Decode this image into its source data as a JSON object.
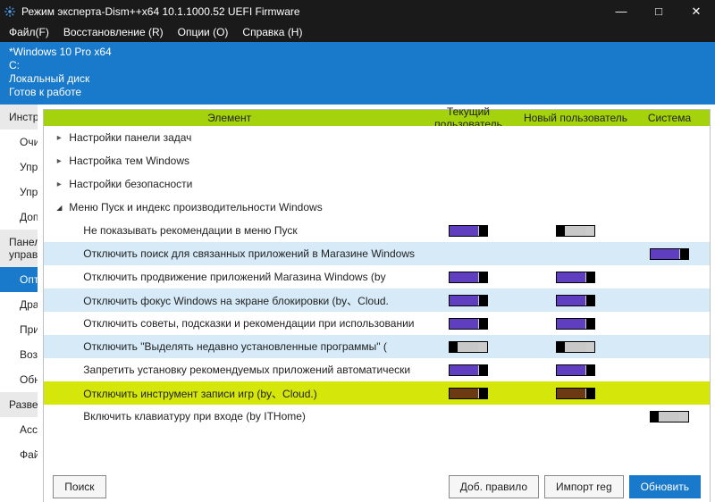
{
  "window": {
    "title": "Режим эксперта-Dism++x64 10.1.1000.52 UEFI Firmware"
  },
  "menu": {
    "file": "Файл(F)",
    "restore": "Восстановление (R)",
    "options": "Опции (O)",
    "help": "Справка (H)"
  },
  "info": {
    "line1": "*Windows 10 Pro x64",
    "line2": "C:",
    "line3": "Локальный диск",
    "line4": "Готов к работе"
  },
  "sidebar": {
    "categories": [
      {
        "label": "Инструменты",
        "items": [
          "Очистка",
          "Управление загрузкой",
          "Управление Appx",
          "Дополнительно"
        ]
      },
      {
        "label": "Панель управления",
        "items": [
          "Оптимизация",
          "Драйверы",
          "Приложения и возможности",
          "Возможности",
          "Обновления"
        ],
        "selectedIndex": 0
      },
      {
        "label": "Развертывание",
        "items": [
          "Ассоциации файлов",
          "Файл ответов"
        ]
      }
    ]
  },
  "columns": {
    "element": "Элемент",
    "current_user": "Текущий пользователь",
    "new_user": "Новый пользователь",
    "system": "Система"
  },
  "groups": [
    {
      "label": "Настройки панели задач",
      "expanded": false
    },
    {
      "label": "Настройка тем Windows",
      "expanded": false
    },
    {
      "label": "Настройки безопасности",
      "expanded": false
    },
    {
      "label": "Меню Пуск и индекс производительности Windows",
      "expanded": true,
      "children": [
        {
          "label": "Не показывать рекомендации в меню Пуск",
          "cu": "on",
          "nu": "off",
          "sys": null,
          "alt": false
        },
        {
          "label": "Отключить поиск для связанных приложений в Магазине Windows",
          "cu": null,
          "nu": null,
          "sys": "on",
          "alt": true
        },
        {
          "label": "Отключить продвижение приложений Магазина Windows (by",
          "cu": "on",
          "nu": "on",
          "sys": null,
          "alt": false
        },
        {
          "label": "Отключить фокус Windows на экране блокировки (by、Cloud.",
          "cu": "on",
          "nu": "on",
          "sys": null,
          "alt": true
        },
        {
          "label": "Отключить советы, подсказки и рекомендации при использовании",
          "cu": "on",
          "nu": "on",
          "sys": null,
          "alt": false
        },
        {
          "label": "Отключить \"Выделять недавно установленные программы\" (",
          "cu": "off",
          "nu": "off",
          "sys": null,
          "alt": true
        },
        {
          "label": "Запретить установку рекомендуемых приложений автоматически",
          "cu": "on",
          "nu": "on",
          "sys": null,
          "alt": false
        },
        {
          "label": "Отключить инструмент записи игр (by、Cloud.)",
          "cu": "on-brown",
          "nu": "on-brown",
          "sys": null,
          "alt": false,
          "hl": true
        },
        {
          "label": "Включить клавиатуру при входе (by ITHome)",
          "cu": null,
          "nu": null,
          "sys": "off",
          "alt": false
        }
      ]
    }
  ],
  "footer": {
    "search": "Поиск",
    "add_rule": "Доб. правило",
    "import_reg": "Импорт reg",
    "refresh": "Обновить"
  }
}
